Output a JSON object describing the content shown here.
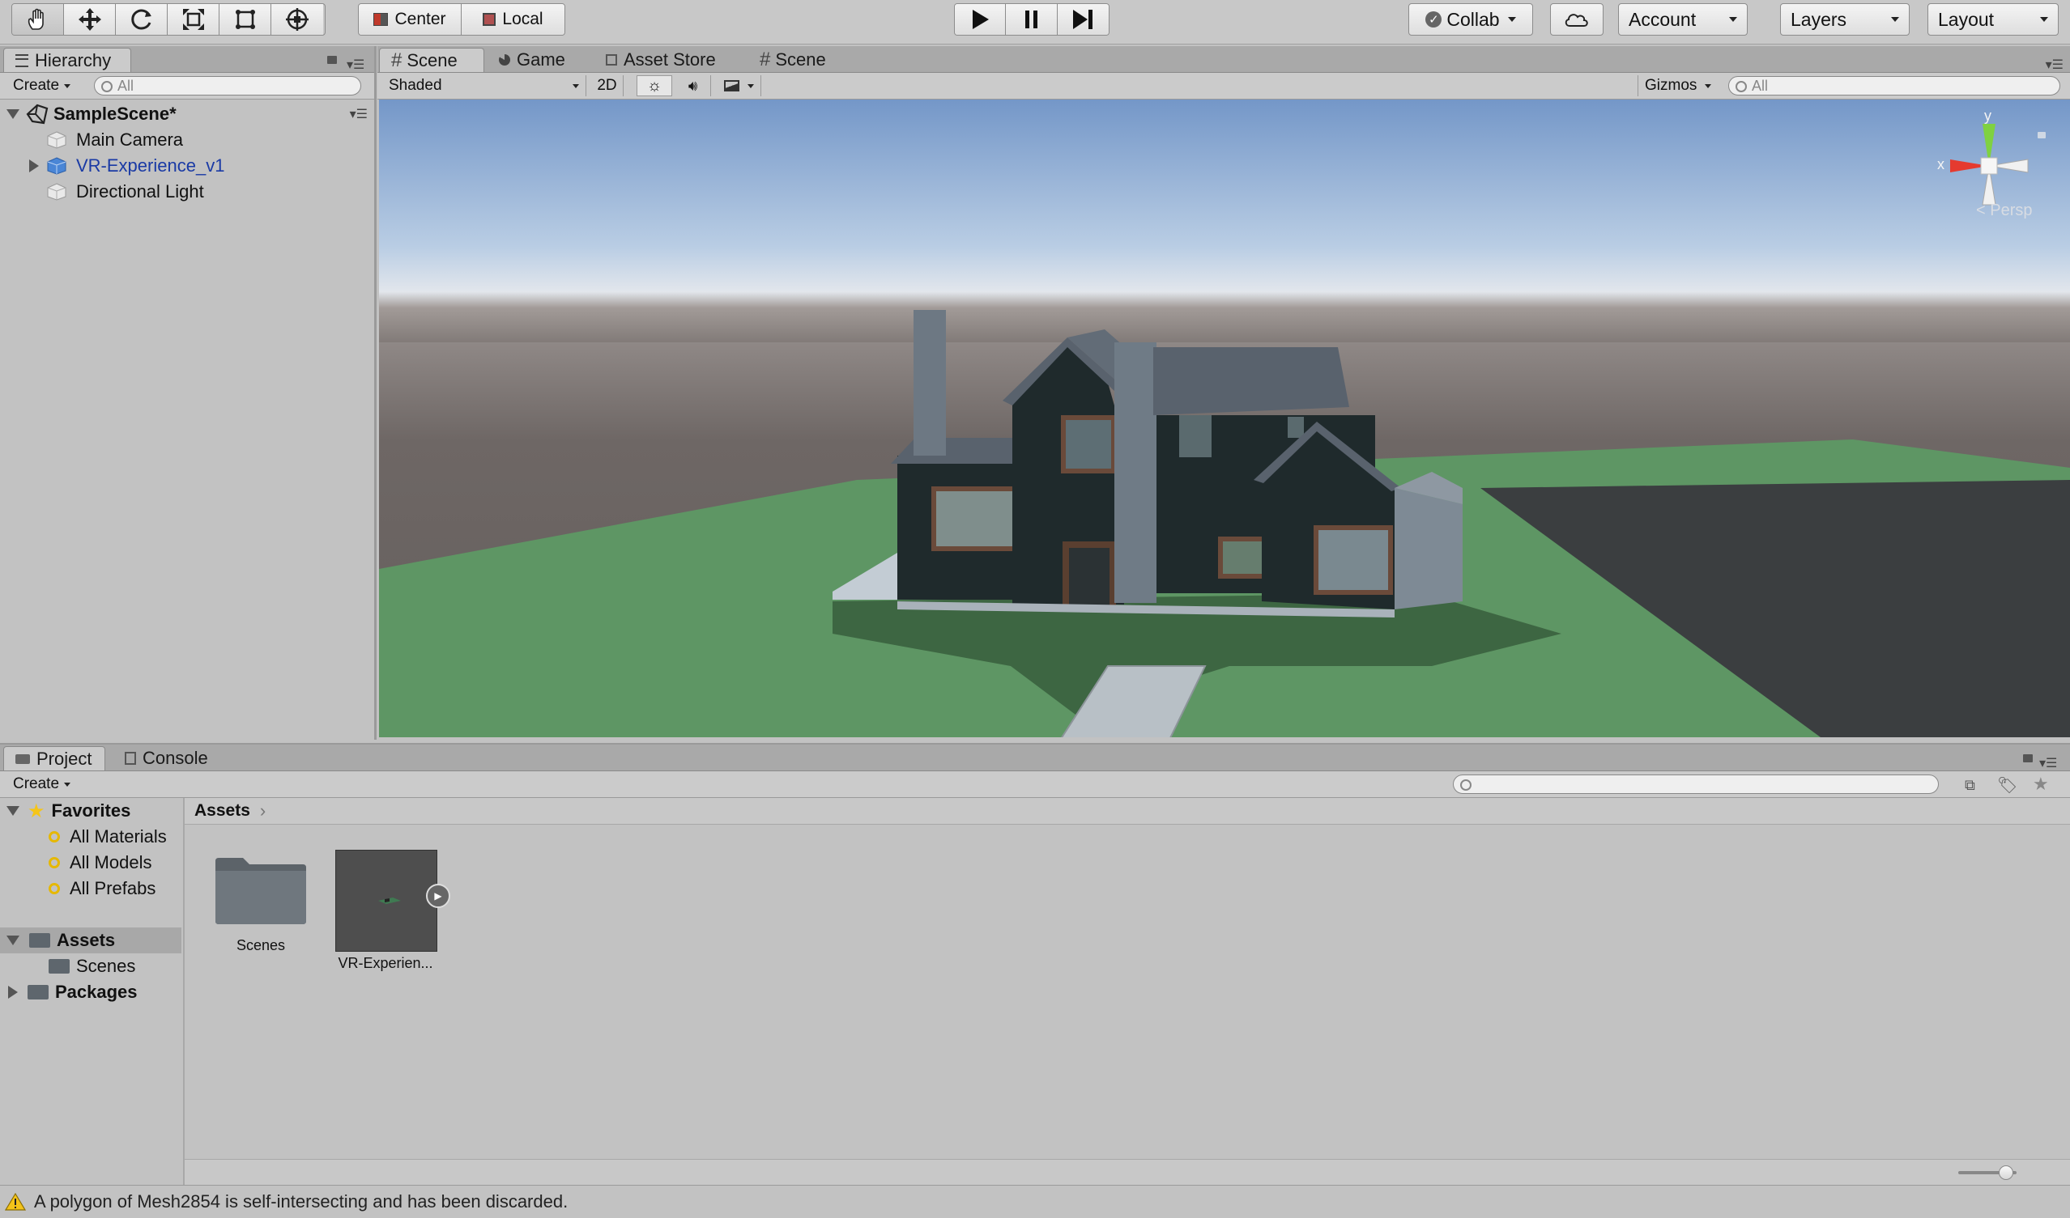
{
  "toolbar": {
    "tools": [
      "hand-tool",
      "move-tool",
      "rotate-tool",
      "scale-tool",
      "rect-tool",
      "transform-tool"
    ],
    "pivot_label": "Center",
    "space_label": "Local",
    "collab_label": "Collab",
    "account_label": "Account",
    "layers_label": "Layers",
    "layout_label": "Layout"
  },
  "hierarchy": {
    "tab_label": "Hierarchy",
    "create_label": "Create",
    "search_placeholder": "All",
    "scene_name": "SampleScene*",
    "items": [
      {
        "label": "Main Camera"
      },
      {
        "label": "VR-Experience_v1"
      },
      {
        "label": "Directional Light"
      }
    ]
  },
  "scene_view": {
    "tabs": [
      "Scene",
      "Game",
      "Asset Store",
      "Scene"
    ],
    "shading_mode": "Shaded",
    "mode_2d_label": "2D",
    "gizmos_label": "Gizmos",
    "search_placeholder": "All",
    "gizmo_x": "x",
    "gizmo_y": "y",
    "persp_label": "Persp"
  },
  "project": {
    "tabs": [
      "Project",
      "Console"
    ],
    "create_label": "Create",
    "favorites_label": "Favorites",
    "favorites": [
      "All Materials",
      "All Models",
      "All Prefabs"
    ],
    "assets_label": "Assets",
    "assets_children": [
      "Scenes"
    ],
    "packages_label": "Packages",
    "breadcrumb": "Assets",
    "grid_items": [
      {
        "label": "Scenes"
      },
      {
        "label": "VR-Experien..."
      }
    ]
  },
  "status": {
    "message": "A polygon of Mesh2854 is self-intersecting and has been discarded."
  },
  "colors": {
    "sky_top": "#7a9ccb",
    "ground": "#6b6462",
    "grass": "#5e9764",
    "house_wall": "#1f2a2c",
    "roof": "#59626d",
    "selected_blue": "#1a3aa5"
  }
}
